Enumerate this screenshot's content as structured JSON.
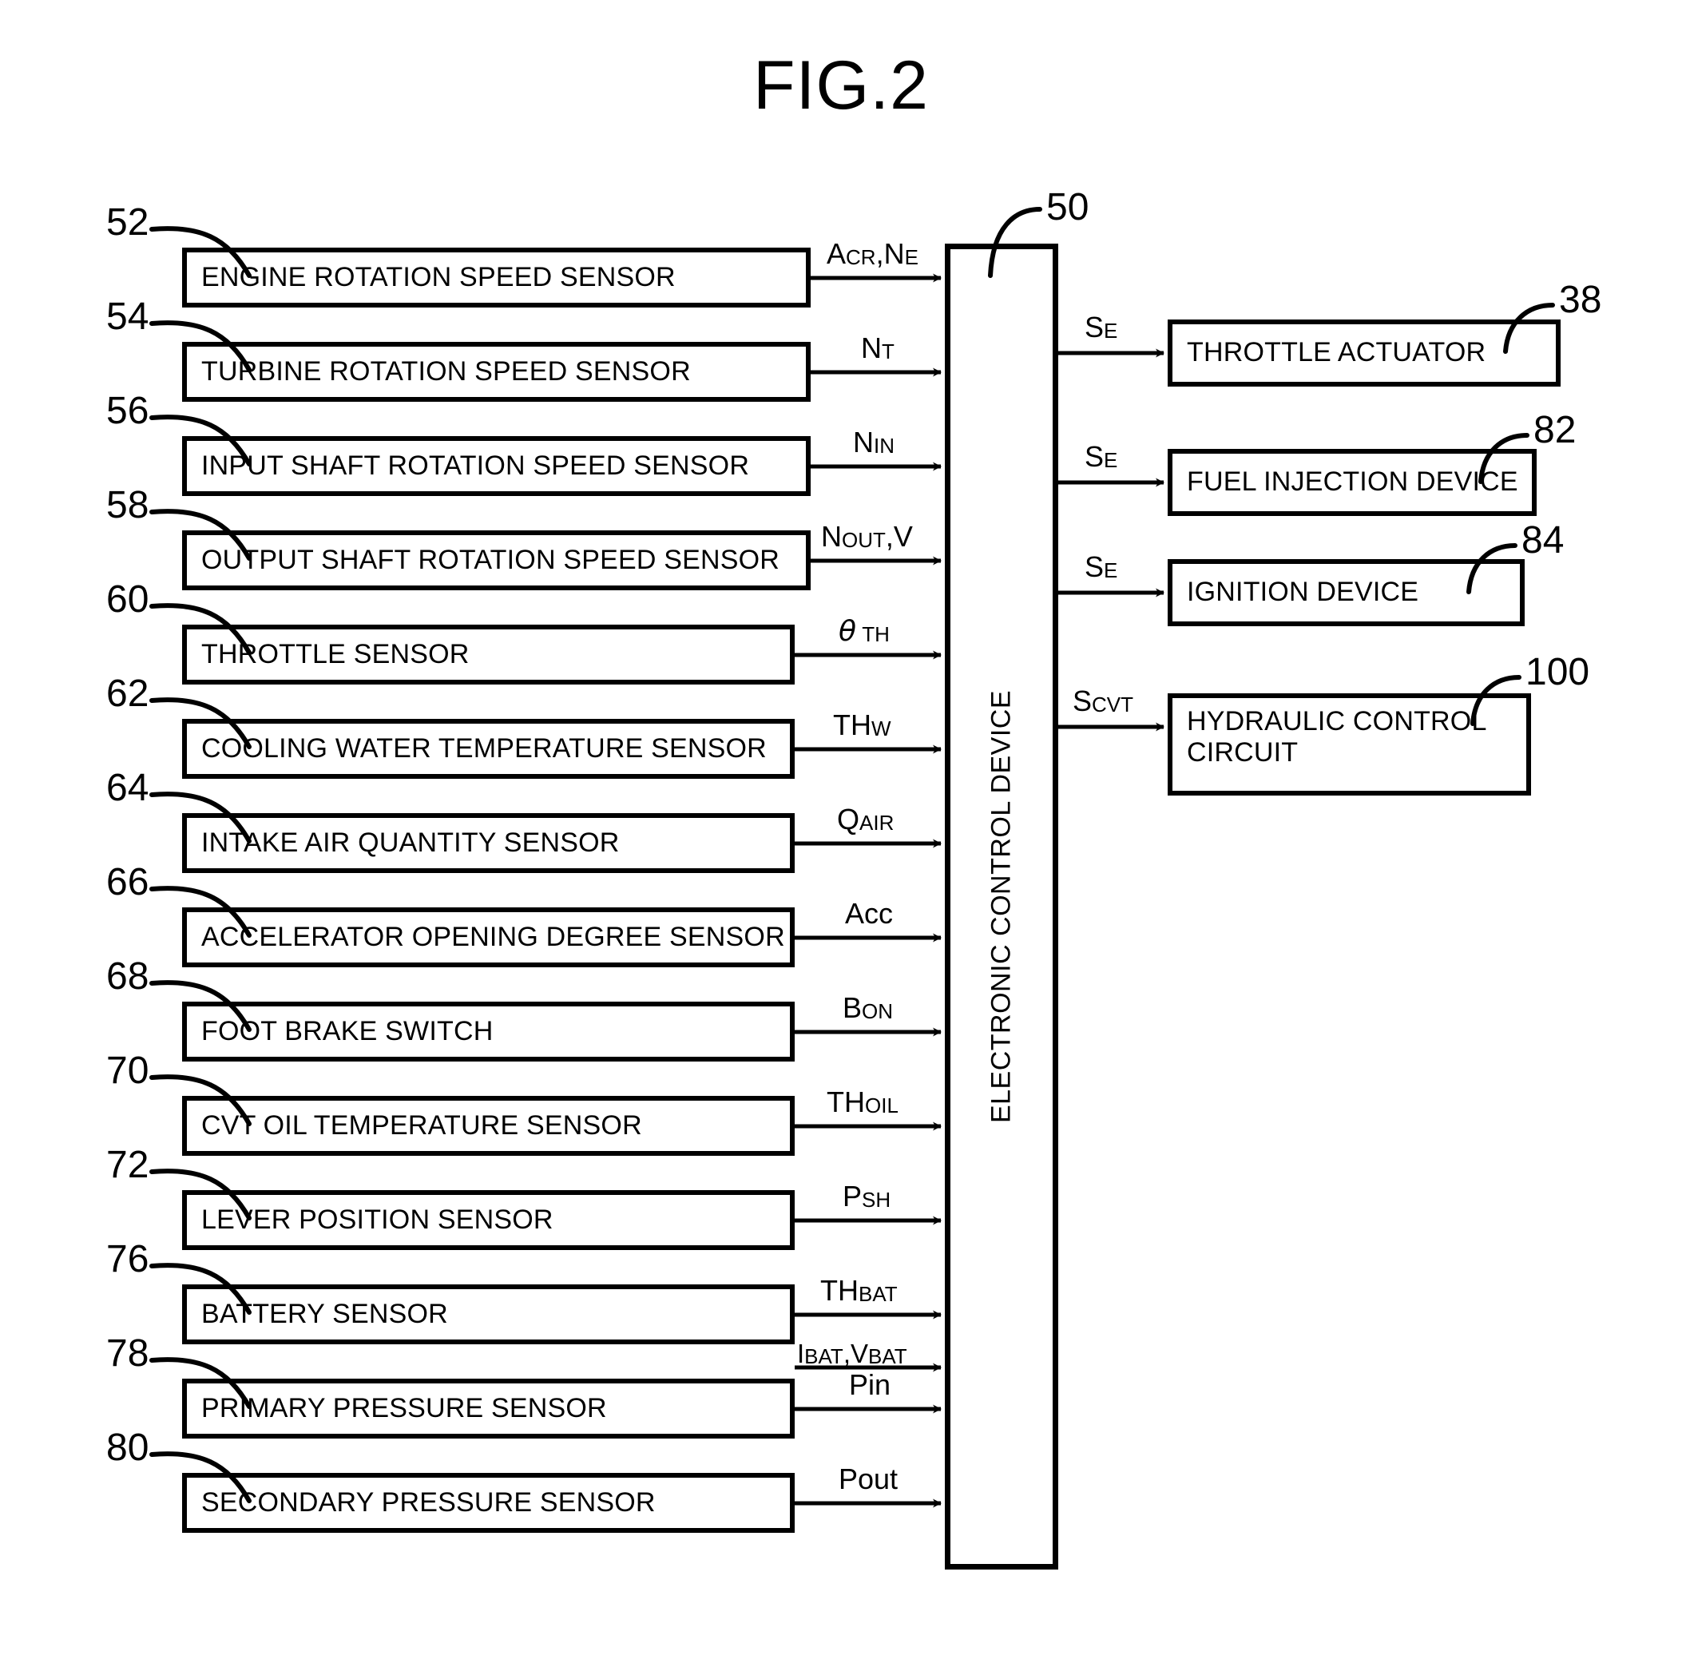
{
  "figure": {
    "title": "FIG.2"
  },
  "ecu": {
    "label": "ELECTRONIC CONTROL DEVICE",
    "ref": "50"
  },
  "sensors": [
    {
      "ref": "52",
      "label": "ENGINE ROTATION SPEED SENSOR",
      "signal": "Acr,Ne",
      "signal_plain": "ACR,NE"
    },
    {
      "ref": "54",
      "label": "TURBINE ROTATION SPEED SENSOR",
      "signal": "Nt",
      "signal_plain": "NT"
    },
    {
      "ref": "56",
      "label": "INPUT SHAFT ROTATION SPEED SENSOR",
      "signal": "Nin",
      "signal_plain": "NIN"
    },
    {
      "ref": "58",
      "label": "OUTPUT SHAFT ROTATION SPEED SENSOR",
      "signal": "Nout,V",
      "signal_plain": "NOUT,V"
    },
    {
      "ref": "60",
      "label": "THROTTLE SENSOR",
      "signal": "θth",
      "signal_plain": "θTH"
    },
    {
      "ref": "62",
      "label": "COOLING WATER TEMPERATURE SENSOR",
      "signal": "THw",
      "signal_plain": "THW"
    },
    {
      "ref": "64",
      "label": "INTAKE AIR QUANTITY SENSOR",
      "signal": "Qair",
      "signal_plain": "QAIR"
    },
    {
      "ref": "66",
      "label": "ACCELERATOR OPENING DEGREE SENSOR",
      "signal": "Acc",
      "signal_plain": "Acc"
    },
    {
      "ref": "68",
      "label": "FOOT BRAKE SWITCH",
      "signal": "Bon",
      "signal_plain": "BON"
    },
    {
      "ref": "70",
      "label": "CVT OIL TEMPERATURE SENSOR",
      "signal": "THoil",
      "signal_plain": "THOIL"
    },
    {
      "ref": "72",
      "label": "LEVER POSITION SENSOR",
      "signal": "Psh",
      "signal_plain": "PSH"
    },
    {
      "ref": "76",
      "label": "BATTERY SENSOR",
      "signal": "THbat",
      "signal_plain": "THBAT",
      "signal2": "Ibat,Vbat",
      "signal2_plain": "IBAT,VBAT"
    },
    {
      "ref": "78",
      "label": "PRIMARY PRESSURE SENSOR",
      "signal": "Pin",
      "signal_plain": "Pin"
    },
    {
      "ref": "80",
      "label": "SECONDARY PRESSURE SENSOR",
      "signal": "Pout",
      "signal_plain": "Pout"
    }
  ],
  "actuators": [
    {
      "ref": "38",
      "label": "THROTTLE ACTUATOR",
      "signal": "Se",
      "signal_plain": "SE"
    },
    {
      "ref": "82",
      "label": "FUEL INJECTION DEVICE",
      "signal": "Se",
      "signal_plain": "SE"
    },
    {
      "ref": "84",
      "label": "IGNITION DEVICE",
      "signal": "Se",
      "signal_plain": "SE"
    },
    {
      "ref": "100",
      "label": "HYDRAULIC CONTROL CIRCUIT",
      "signal": "Scvt",
      "signal_plain": "SCVT",
      "line1": "HYDRAULIC CONTROL",
      "line2": "CIRCUIT"
    }
  ],
  "colors": {
    "ink": "#000000",
    "paper": "#ffffff"
  }
}
